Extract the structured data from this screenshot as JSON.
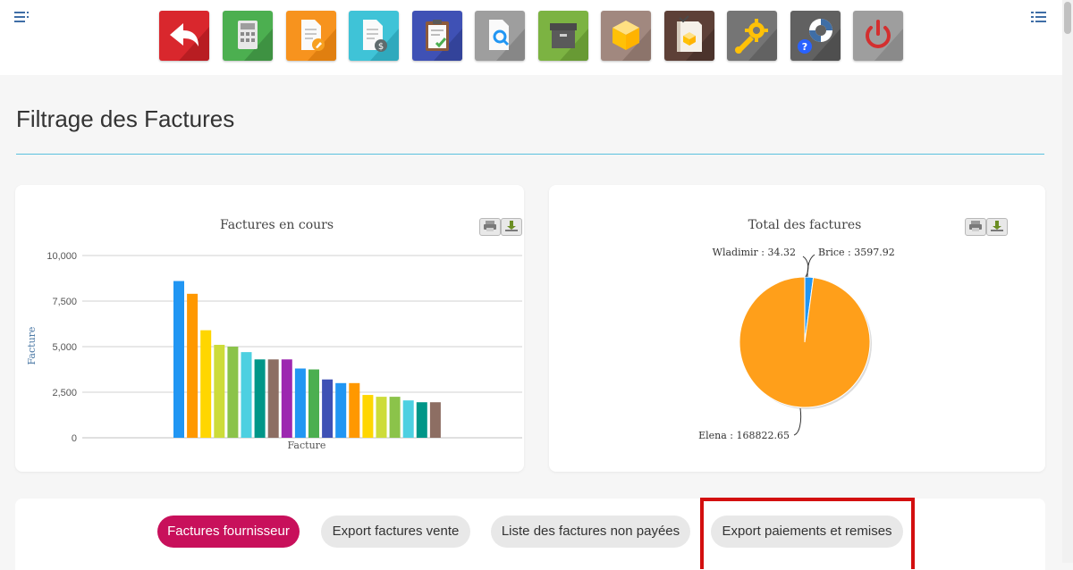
{
  "page": {
    "title": "Filtrage des Factures"
  },
  "toolbar": {
    "tools": [
      {
        "icon": "back-arrow-icon",
        "color": "#d9272d"
      },
      {
        "icon": "calculator-icon",
        "color": "#4caf50"
      },
      {
        "icon": "edit-document-icon",
        "color": "#f7931e"
      },
      {
        "icon": "invoice-dollar-icon",
        "color": "#3fc3d7"
      },
      {
        "icon": "clipboard-check-icon",
        "color": "#3f51b5"
      },
      {
        "icon": "document-search-icon",
        "color": "#9e9e9e"
      },
      {
        "icon": "archive-box-icon",
        "color": "#7cb342"
      },
      {
        "icon": "product-cube-icon",
        "color": "#a1887f"
      },
      {
        "icon": "catalog-book-icon",
        "color": "#5d4037"
      },
      {
        "icon": "settings-wrench-icon",
        "color": "#757575"
      },
      {
        "icon": "help-lifebuoy-icon",
        "color": "#616161"
      },
      {
        "icon": "power-icon",
        "color": "#9e9e9e"
      }
    ]
  },
  "bar_chart": {
    "buttons": {
      "print": "print-icon",
      "download": "download-icon"
    }
  },
  "pie_chart": {
    "buttons": {
      "print": "print-icon",
      "download": "download-icon"
    }
  },
  "chart_data": [
    {
      "type": "bar",
      "title": "Factures en cours",
      "xlabel": "Facture",
      "ylabel": "Facture",
      "ylim": [
        0,
        10000
      ],
      "yticks": [
        "10,000",
        "7,500",
        "5,000",
        "2,500",
        "0"
      ],
      "grid": true,
      "values": [
        8600,
        7900,
        5900,
        5100,
        5000,
        4700,
        4300,
        4300,
        4300,
        3800,
        3750,
        3200,
        3000,
        3000,
        2350,
        2250,
        2250,
        2050,
        1950,
        1950
      ],
      "colors": [
        "#2196f3",
        "#ff9800",
        "#ffd600",
        "#cddc39",
        "#8bc34a",
        "#4dd0e1",
        "#009688",
        "#8d6e63",
        "#9c27b0",
        "#2196f3",
        "#4caf50",
        "#3f51b5",
        "#2196f3",
        "#ff9800",
        "#ffd600",
        "#cddc39",
        "#8bc34a",
        "#4dd0e1",
        "#009688",
        "#8d6e63"
      ]
    },
    {
      "type": "pie",
      "title": "Total des factures",
      "slices": [
        {
          "label": "Wladimir : 34.32",
          "value": 34.32,
          "color": "#3f51b5"
        },
        {
          "label": "Brice : 3597.92",
          "value": 3597.92,
          "color": "#2196f3"
        },
        {
          "label": "Elena : 168822.65",
          "value": 168822.65,
          "color": "#ff9f1a"
        }
      ]
    }
  ],
  "actions": {
    "supplier_invoices": "Factures fournisseur",
    "export_sales": "Export factures vente",
    "unpaid_list": "Liste des factures non payées",
    "export_payments": "Export paiements et remises"
  }
}
